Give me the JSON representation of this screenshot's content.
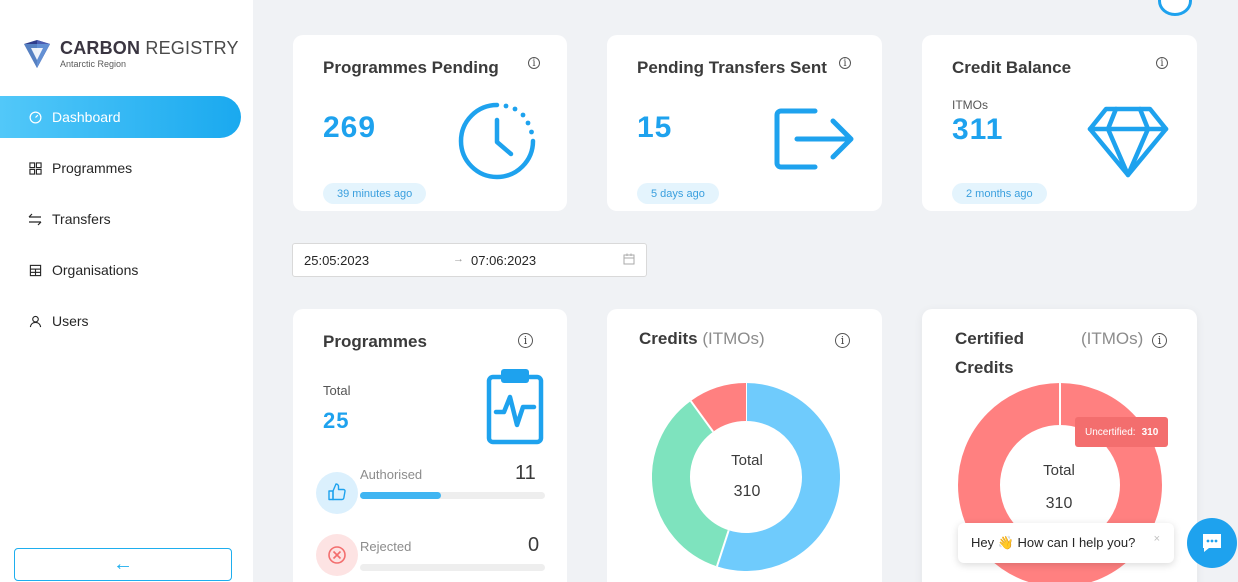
{
  "brand": {
    "title_bold": "CARBON",
    "title_light": "REGISTRY",
    "subtitle": "Antarctic Region"
  },
  "sidebar": {
    "items": [
      {
        "label": "Dashboard",
        "icon": "dashboard-icon",
        "active": true
      },
      {
        "label": "Programmes",
        "icon": "grid-icon",
        "active": false
      },
      {
        "label": "Transfers",
        "icon": "transfer-icon",
        "active": false
      },
      {
        "label": "Organisations",
        "icon": "building-icon",
        "active": false
      },
      {
        "label": "Users",
        "icon": "user-icon",
        "active": false
      }
    ],
    "collapse_label": "←"
  },
  "stats": [
    {
      "title": "Programmes Pending",
      "value": "269",
      "time": "39 minutes ago",
      "icon": "clock-icon"
    },
    {
      "title": "Pending Transfers Sent",
      "value": "15",
      "time": "5 days ago",
      "icon": "export-icon"
    },
    {
      "title": "Credit Balance",
      "sub": "ITMOs",
      "value": "311",
      "time": "2 months ago",
      "icon": "diamond-icon"
    }
  ],
  "date_range": {
    "start": "25:05:2023",
    "arrow": "→",
    "end": "07:06:2023"
  },
  "programmes_card": {
    "title": "Programmes",
    "total_label": "Total",
    "total_value": "25",
    "rows": [
      {
        "label": "Authorised",
        "value": "11",
        "progress": 0.44
      },
      {
        "label": "Rejected",
        "value": "0",
        "progress": 0
      }
    ]
  },
  "credits_card": {
    "title": "Credits",
    "unit": "(ITMOs)",
    "center_label": "Total",
    "center_value": "310"
  },
  "certified_card": {
    "title_line1": "Certified",
    "title_line2": "Credits",
    "unit": "(ITMOs)",
    "center_label": "Total",
    "center_value": "310",
    "tooltip_label": "Uncertified:",
    "tooltip_value": "310"
  },
  "chat": {
    "message": "Hey 👋 How can I help you?",
    "close": "×"
  },
  "colors": {
    "accent": "#1ea2ee",
    "green": "#7ee3be",
    "blue_slice": "#6fcbfc",
    "red": "#ff8080"
  },
  "chart_data": [
    {
      "type": "pie",
      "title": "Credits",
      "categories": [
        "blue",
        "green",
        "red"
      ],
      "values": [
        55,
        35,
        10
      ],
      "center_text": "Total 310"
    },
    {
      "type": "pie",
      "title": "Certified Credits",
      "categories": [
        "Uncertified"
      ],
      "values": [
        310
      ],
      "center_text": "Total 310"
    }
  ]
}
